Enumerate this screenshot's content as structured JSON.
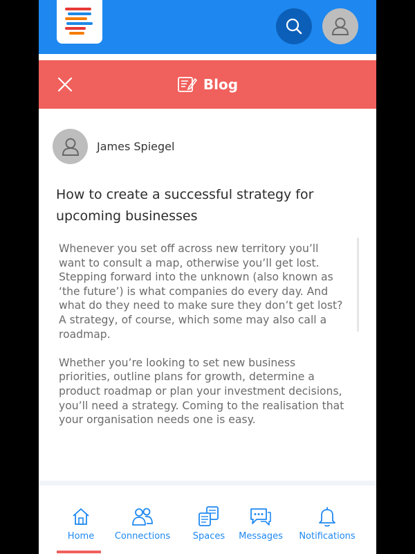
{
  "colors": {
    "app_bar": "#1e88f0",
    "search_button": "#0c5fb8",
    "blog_header": "#f0605c",
    "nav_text": "#1e88f0",
    "active_indicator": "#f0605c",
    "avatar": "#bdbdbd"
  },
  "app_bar": {
    "logo_icon": "stripes-logo-icon",
    "search_icon": "search-icon",
    "profile_icon": "user-icon"
  },
  "blog_header": {
    "title": "Blog",
    "close_icon": "close-icon",
    "blog_icon": "edit-document-icon"
  },
  "post": {
    "author": "James Spiegel",
    "title": "How to create a successful strategy for upcoming businesses",
    "paragraphs": [
      "Whenever you set off across new territory you’ll want to consult a map, otherwise you’ll get lost. Stepping forward into the unknown (also known as ‘the future’) is what companies do every day. And what do they need to make sure they don’t get lost? A strategy, of course, which some may also call a roadmap.",
      "Whether you’re looking to set new business priorities, outline plans for growth, determine a product roadmap or plan your investment decisions, you’ll need a strategy. Coming to the realisation that your organisation needs one is easy."
    ]
  },
  "bottom_nav": {
    "items": [
      {
        "label": "Home",
        "icon": "home-icon",
        "active": true
      },
      {
        "label": "Connections",
        "icon": "people-icon",
        "active": false
      },
      {
        "label": "Spaces",
        "icon": "spaces-icon",
        "active": false
      },
      {
        "label": "Messages",
        "icon": "chat-icon",
        "active": false
      },
      {
        "label": "Notifications",
        "icon": "bell-icon",
        "active": false
      }
    ]
  }
}
